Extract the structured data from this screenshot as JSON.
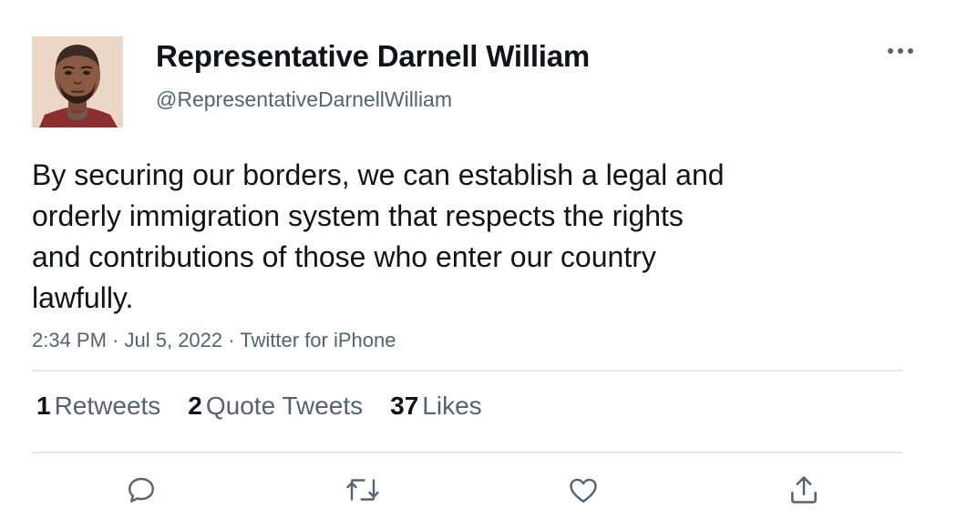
{
  "user": {
    "display_name": "Representative Darnell William",
    "handle": "@RepresentativeDarnellWilliam"
  },
  "tweet": {
    "lines": [
      "By securing our borders, we can establish a legal and",
      "orderly immigration system that respects the rights",
      "and contributions of those who enter our country",
      "lawfully."
    ],
    "time": "2:34 PM",
    "date": "Jul 5, 2022",
    "source": "Twitter for iPhone",
    "separator": " · "
  },
  "stats": {
    "retweets": {
      "count": "1",
      "label": "Retweets"
    },
    "quotes": {
      "count": "2",
      "label": "Quote Tweets"
    },
    "likes": {
      "count": "37",
      "label": "Likes"
    }
  },
  "icons": {
    "more": "more-horizontal-icon",
    "reply": "reply-icon",
    "retweet": "retweet-icon",
    "like": "heart-icon",
    "share": "share-icon"
  },
  "colors": {
    "text_primary": "#0f1419",
    "text_secondary": "#536471",
    "divider": "#e3e6e8"
  }
}
